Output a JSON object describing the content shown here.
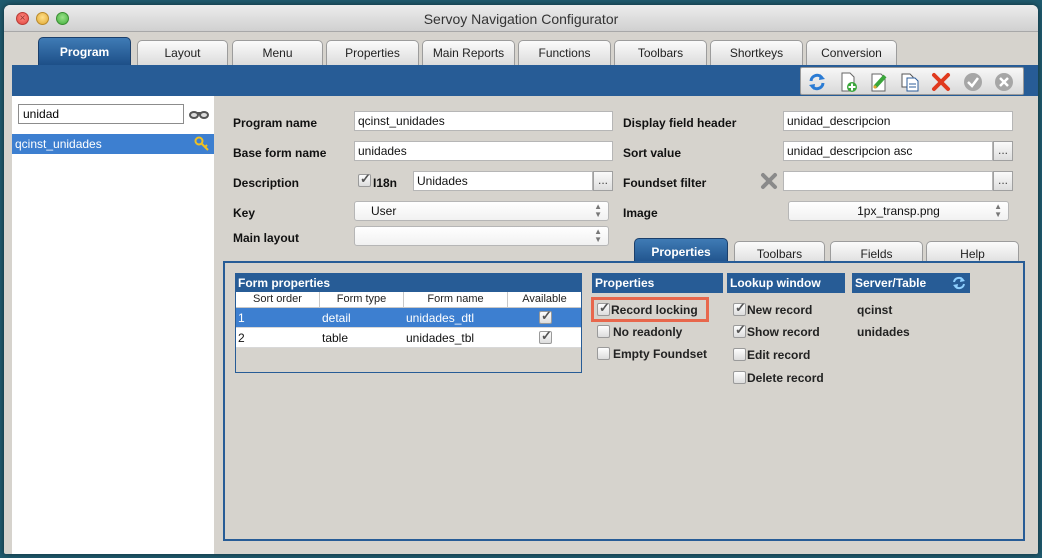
{
  "window": {
    "title": "Servoy Navigation Configurator"
  },
  "main_tabs": [
    "Program",
    "Layout",
    "Menu",
    "Properties",
    "Main Reports",
    "Functions",
    "Toolbars",
    "Shortkeys",
    "Conversion"
  ],
  "toolbar": {
    "icons": [
      "refresh-icon",
      "new-record-icon",
      "edit-record-icon",
      "copy-record-icon",
      "delete-record-icon",
      "save-icon",
      "cancel-icon"
    ]
  },
  "sidebar": {
    "search_value": "unidad",
    "items": [
      {
        "label": "qcinst_unidades"
      }
    ]
  },
  "form": {
    "program_name_label": "Program name",
    "program_name_value": "qcinst_unidades",
    "base_form_name_label": "Base form name",
    "base_form_name_value": "unidades",
    "description_label": "Description",
    "i18n_label": "I18n",
    "description_value": "Unidades",
    "key_label": "Key",
    "key_value": "User",
    "main_layout_label": "Main layout",
    "main_layout_value": "",
    "display_field_header_label": "Display field header",
    "display_field_header_value": "unidad_descripcion",
    "sort_value_label": "Sort value",
    "sort_value_value": "unidad_descripcion asc",
    "foundset_filter_label": "Foundset filter",
    "foundset_filter_value": "",
    "image_label": "Image",
    "image_value": "1px_transp.png",
    "ellipsis": "..."
  },
  "sub_tabs": [
    "Properties",
    "Toolbars",
    "Fields",
    "Help"
  ],
  "form_properties": {
    "title": "Form properties",
    "columns": [
      "Sort order",
      "Form type",
      "Form name",
      "Available"
    ],
    "rows": [
      {
        "sort_order": "1",
        "form_type": "detail",
        "form_name": "unidades_dtl",
        "available": true
      },
      {
        "sort_order": "2",
        "form_type": "table",
        "form_name": "unidades_tbl",
        "available": true
      }
    ]
  },
  "properties": {
    "header": "Properties",
    "options": [
      {
        "label": "Record locking",
        "checked": true
      },
      {
        "label": "No readonly",
        "checked": false
      },
      {
        "label": "Empty Foundset",
        "checked": false
      }
    ]
  },
  "lookup_window": {
    "header": "Lookup window",
    "options": [
      {
        "label": "New record",
        "checked": true
      },
      {
        "label": "Show record",
        "checked": true
      },
      {
        "label": "Edit record",
        "checked": false
      },
      {
        "label": "Delete record",
        "checked": false
      }
    ]
  },
  "server_table": {
    "header": "Server/Table",
    "server": "qcinst",
    "table": "unidades"
  },
  "colors": {
    "accent": "#275c96",
    "selection": "#3d7fd0",
    "highlight": "#e8674c"
  }
}
